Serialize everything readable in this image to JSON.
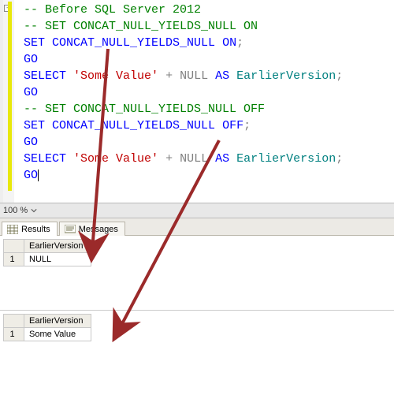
{
  "editor": {
    "collapse_glyph": "-",
    "lines": [
      {
        "tokens": [
          {
            "t": "-- Before SQL Server 2012",
            "c": "c-green"
          }
        ]
      },
      {
        "tokens": [
          {
            "t": "-- SET CONCAT_NULL_YIELDS_NULL ON",
            "c": "c-green"
          }
        ]
      },
      {
        "tokens": [
          {
            "t": "SET",
            "c": "c-blue"
          },
          {
            "t": " CONCAT_NULL_YIELDS_NULL ",
            "c": "c-blue"
          },
          {
            "t": "ON",
            "c": "c-blue"
          },
          {
            "t": ";",
            "c": "c-gray"
          }
        ]
      },
      {
        "tokens": [
          {
            "t": "GO",
            "c": "c-blue"
          }
        ]
      },
      {
        "tokens": [
          {
            "t": "SELECT",
            "c": "c-blue"
          },
          {
            "t": " ",
            "c": "c-black"
          },
          {
            "t": "'Some Value'",
            "c": "c-red"
          },
          {
            "t": " ",
            "c": "c-black"
          },
          {
            "t": "+",
            "c": "c-gray"
          },
          {
            "t": " ",
            "c": "c-black"
          },
          {
            "t": "NULL",
            "c": "c-gray"
          },
          {
            "t": " ",
            "c": "c-black"
          },
          {
            "t": "AS",
            "c": "c-blue"
          },
          {
            "t": " ",
            "c": "c-black"
          },
          {
            "t": "EarlierVersion",
            "c": "c-teal"
          },
          {
            "t": ";",
            "c": "c-gray"
          }
        ]
      },
      {
        "tokens": [
          {
            "t": "GO",
            "c": "c-blue"
          }
        ]
      },
      {
        "tokens": [
          {
            "t": "-- SET CONCAT_NULL_YIELDS_NULL OFF",
            "c": "c-green"
          }
        ]
      },
      {
        "tokens": [
          {
            "t": "SET",
            "c": "c-blue"
          },
          {
            "t": " CONCAT_NULL_YIELDS_NULL ",
            "c": "c-blue"
          },
          {
            "t": "OFF",
            "c": "c-blue"
          },
          {
            "t": ";",
            "c": "c-gray"
          }
        ]
      },
      {
        "tokens": [
          {
            "t": "GO",
            "c": "c-blue"
          }
        ]
      },
      {
        "tokens": [
          {
            "t": "SELECT",
            "c": "c-blue"
          },
          {
            "t": " ",
            "c": "c-black"
          },
          {
            "t": "'Some Value'",
            "c": "c-red"
          },
          {
            "t": " ",
            "c": "c-black"
          },
          {
            "t": "+",
            "c": "c-gray"
          },
          {
            "t": " ",
            "c": "c-black"
          },
          {
            "t": "NULL",
            "c": "c-gray"
          },
          {
            "t": " ",
            "c": "c-black"
          },
          {
            "t": "AS",
            "c": "c-blue"
          },
          {
            "t": " ",
            "c": "c-black"
          },
          {
            "t": "EarlierVersion",
            "c": "c-teal"
          },
          {
            "t": ";",
            "c": "c-gray"
          }
        ]
      },
      {
        "tokens": [
          {
            "t": "GO",
            "c": "c-blue"
          }
        ]
      }
    ]
  },
  "zoom": {
    "value": "100 %"
  },
  "tabs": {
    "results": "Results",
    "messages": "Messages"
  },
  "grid1": {
    "header": "EarlierVersion",
    "rownum": "1",
    "value": "NULL"
  },
  "grid2": {
    "header": "EarlierVersion",
    "rownum": "1",
    "value": "Some Value"
  },
  "arrows": {
    "color": "#9b2a2a"
  }
}
